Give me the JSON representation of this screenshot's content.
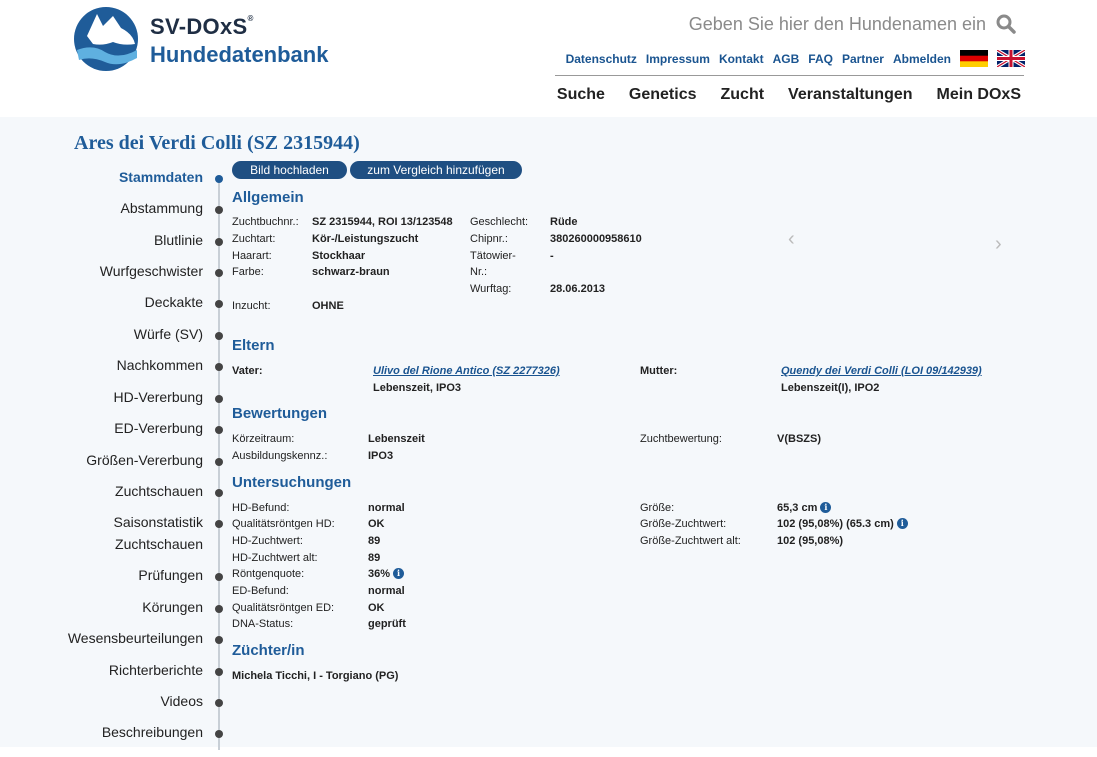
{
  "header": {
    "logo_line1": "SV-DOxS",
    "logo_reg": "®",
    "logo_line2": "Hundedatenbank",
    "search_placeholder": "Geben Sie hier den Hundenamen ein",
    "toplinks": [
      "Datenschutz",
      "Impressum",
      "Kontakt",
      "AGB",
      "FAQ",
      "Partner",
      "Abmelden"
    ],
    "nav": [
      "Suche",
      "Genetics",
      "Zucht",
      "Veranstaltungen",
      "Mein DOxS"
    ]
  },
  "dog": {
    "title": "Ares dei Verdi Colli (SZ 2315944)"
  },
  "sidebar": {
    "items": [
      "Stammdaten",
      "Abstammung",
      "Blutlinie",
      "Wurfgeschwister",
      "Deckakte",
      "Würfe (SV)",
      "Nachkommen",
      "HD-Vererbung",
      "ED-Vererbung",
      "Größen-Vererbung",
      "Zuchtschauen",
      "Saisonstatistik",
      "Zuchtschauen",
      "Prüfungen",
      "Körungen",
      "Wesensbeurteilungen",
      "Richterberichte",
      "Videos",
      "Beschreibungen"
    ]
  },
  "buttons": {
    "upload": "Bild hochladen",
    "compare": "zum Vergleich hinzufügen"
  },
  "allgemein": {
    "title": "Allgemein",
    "zuchtbuchnr_label": "Zuchtbuchnr.:",
    "zuchtbuchnr": "SZ 2315944, ROI 13/123548",
    "zuchtart_label": "Zuchtart:",
    "zuchtart": "Kör-/Leistungszucht",
    "haarart_label": "Haarart:",
    "haarart": "Stockhaar",
    "farbe_label": "Farbe:",
    "farbe": "schwarz-braun",
    "inzucht_label": "Inzucht:",
    "inzucht": "OHNE",
    "geschlecht_label": "Geschlecht:",
    "geschlecht": "Rüde",
    "chipnr_label": "Chipnr.:",
    "chipnr": "380260000958610",
    "taetowier_label": "Tätowier-",
    "taetowier_label2": "Nr.:",
    "taetowier": "-",
    "wurftag_label": "Wurftag:",
    "wurftag": "28.06.2013"
  },
  "eltern": {
    "title": "Eltern",
    "vater_label": "Vater:",
    "vater": "Ulivo del Rione Antico (SZ 2277326)",
    "vater_info": "Lebenszeit, IPO3",
    "mutter_label": "Mutter:",
    "mutter": "Quendy dei Verdi Colli (LOI 09/142939)",
    "mutter_info": "Lebenszeit(I), IPO2"
  },
  "bewertungen": {
    "title": "Bewertungen",
    "koerzeitraum_label": "Körzeitraum:",
    "koerzeitraum": "Lebenszeit",
    "ausbildung_label": "Ausbildungskennz.:",
    "ausbildung": "IPO3",
    "zuchtbewertung_label": "Zuchtbewertung:",
    "zuchtbewertung": "V(BSZS)"
  },
  "untersuchungen": {
    "title": "Untersuchungen",
    "left": [
      {
        "label": "HD-Befund:",
        "value": "normal"
      },
      {
        "label": "Qualitätsröntgen HD:",
        "value": "OK"
      },
      {
        "label": "HD-Zuchtwert:",
        "value": "89"
      },
      {
        "label": "HD-Zuchtwert alt:",
        "value": "89"
      },
      {
        "label": "Röntgenquote:",
        "value": "36%"
      },
      {
        "label": "ED-Befund:",
        "value": "normal"
      },
      {
        "label": "Qualitätsröntgen ED:",
        "value": "OK"
      },
      {
        "label": "DNA-Status:",
        "value": "geprüft"
      }
    ],
    "right": [
      {
        "label": "Größe:",
        "value": "65,3 cm"
      },
      {
        "label": "Größe-Zuchtwert:",
        "value": "102 (95,08%) (65.3 cm)"
      },
      {
        "label": "Größe-Zuchtwert alt:",
        "value": "102 (95,08%)"
      }
    ]
  },
  "zuechter": {
    "title": "Züchter/in",
    "name": "Michela Ticchi, I - Torgiano (PG)"
  },
  "carousel": {
    "prev": "‹",
    "next": "›"
  },
  "icons": {
    "info": "i"
  }
}
